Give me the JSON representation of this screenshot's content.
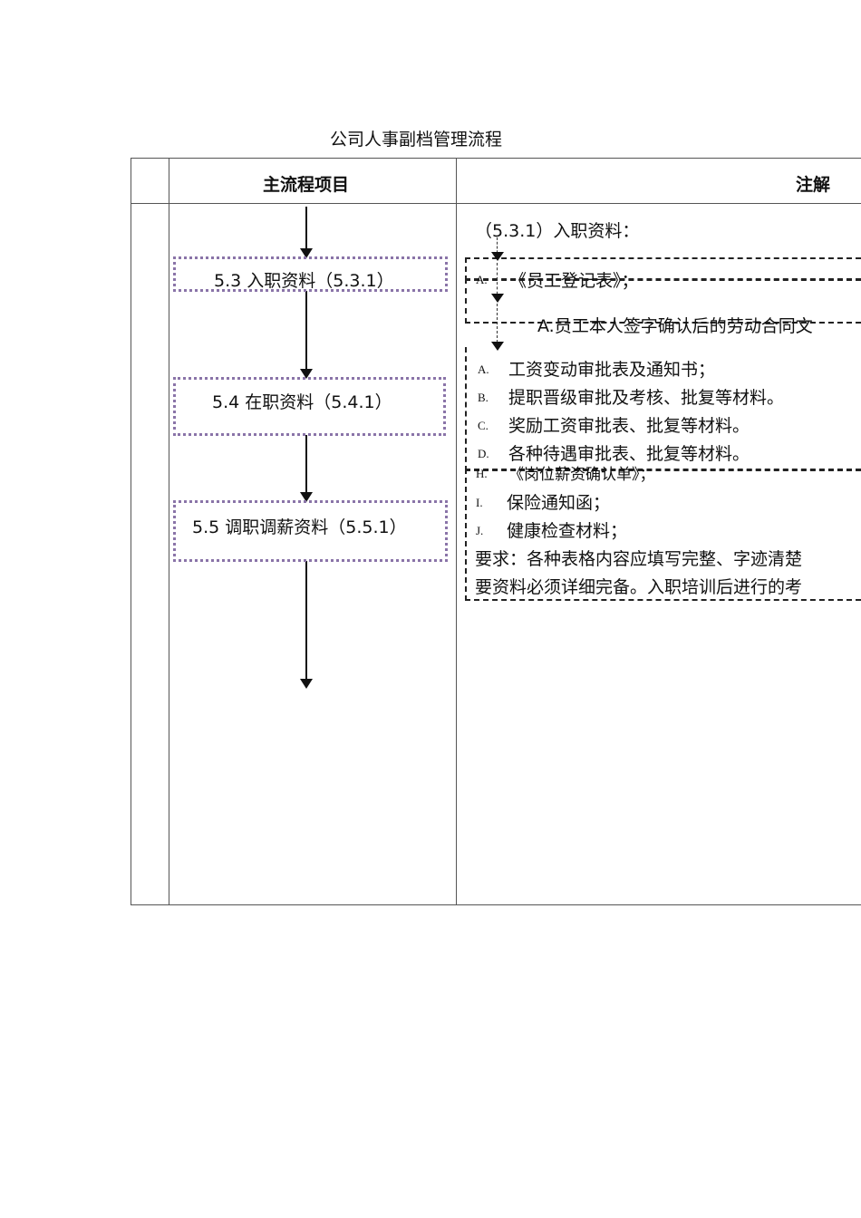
{
  "title": "公司人事副档管理流程",
  "headers": {
    "main": "主流程项目",
    "notes": "注解"
  },
  "flow": [
    {
      "label": "5.3 入职资料（5.3.1）"
    },
    {
      "label": "5.4 在职资料（5.4.1）"
    },
    {
      "label": "5.5 调职调薪资料（5.5.1）"
    }
  ],
  "notes": {
    "heading": "（5.3.1）入职资料：",
    "a_label": "A.",
    "a_text": "《员工登记表》；",
    "contract": "A.员工本人签字确认后的劳动合同文",
    "items": [
      {
        "label": "A.",
        "text": "工资变动审批表及通知书；"
      },
      {
        "label": "B.",
        "text": "提职晋级审批及考核、批复等材料。"
      },
      {
        "label": "C.",
        "text": "奖励工资审批表、批复等材料。"
      },
      {
        "label": "D.",
        "text": "各种待遇审批表、批复等材料。"
      },
      {
        "label": "H.",
        "text": "《岗位薪资确认单》；"
      },
      {
        "label": "I.",
        "text": "保险通知函；"
      },
      {
        "label": "J.",
        "text": "健康检查材料；"
      }
    ],
    "req1": "要求：各种表格内容应填写完整、字迹清楚",
    "req2": "要资料必须详细完备。入职培训后进行的考"
  }
}
